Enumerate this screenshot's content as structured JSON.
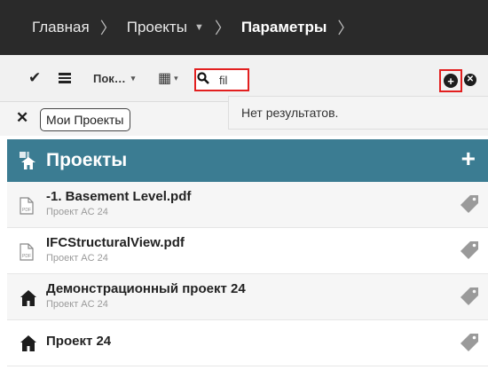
{
  "breadcrumb": {
    "home": "Главная",
    "projects": "Проекты",
    "current": "Параметры",
    "sep": "〉",
    "caret": "▼"
  },
  "toolbar": {
    "check_icon": "✔",
    "view_label": "Пок…",
    "caret": "▾",
    "calendar_icon": "▦",
    "search_icon": "⚲",
    "search_value": "fil",
    "add_icon": "+",
    "close_icon": "✕"
  },
  "filter": {
    "clear_icon": "✕",
    "chip_label": "Мои Проекты"
  },
  "dropdown": {
    "message": "Нет результатов."
  },
  "projects_header": {
    "title": "Проекты",
    "add_label": "+"
  },
  "items": [
    {
      "name": "-1. Basement Level.pdf",
      "subtitle": "Проект AC 24",
      "icon": "pdf-file-icon"
    },
    {
      "name": "IFCStructuralView.pdf",
      "subtitle": "Проект AC 24",
      "icon": "pdf-file-icon"
    },
    {
      "name": "Демонстрационный проект 24",
      "subtitle": "Проект AC 24",
      "icon": "project-house-icon"
    },
    {
      "name": "Проект 24",
      "subtitle": "",
      "icon": "project-house-icon"
    }
  ],
  "colors": {
    "topbar": "#2a2a2a",
    "header_bg": "#3b7c92",
    "highlight": "#e21f1f"
  }
}
